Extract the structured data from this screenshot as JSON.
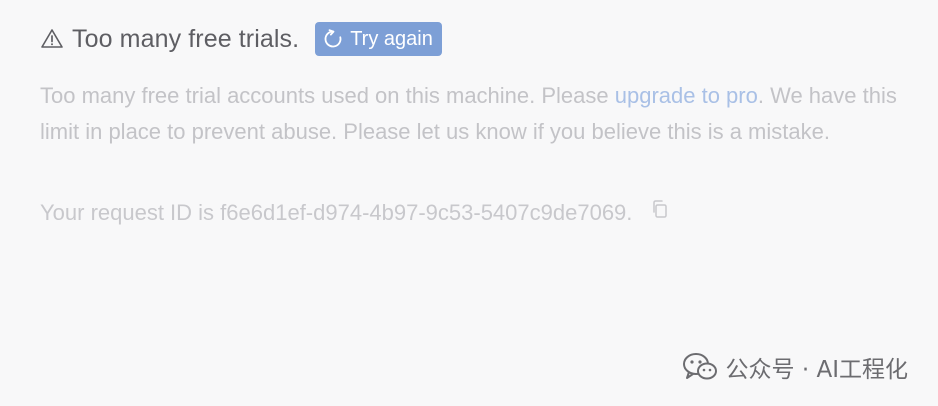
{
  "error": {
    "title": "Too many free trials.",
    "retry_label": "Try again",
    "message_before_link": "Too many free trial accounts used on this machine. Please ",
    "link_text": "upgrade to pro",
    "message_after_link": ". We have this limit in place to prevent abuse. Please let us know if you believe this is a mistake.",
    "request_id_text": "Your request ID is f6e6d1ef-d974-4b97-9c53-5407c9de7069."
  },
  "watermark": {
    "text": "公众号 · AI工程化"
  },
  "icons": {
    "warning": "warning-triangle-icon",
    "retry": "refresh-icon",
    "copy": "copy-icon",
    "watermark": "wechat-icon"
  },
  "colors": {
    "background": "#f8f8f9",
    "button": "#7d9fd6",
    "link": "#a9c0e6"
  }
}
